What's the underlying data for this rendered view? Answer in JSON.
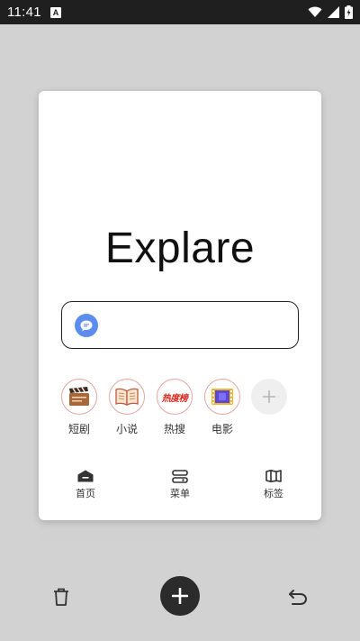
{
  "status_bar": {
    "time": "11:41",
    "app_icon_letter": "A"
  },
  "brand": {
    "title": "Explare"
  },
  "search": {
    "value": "",
    "placeholder": "",
    "engine_icon": "chat-bubble-icon",
    "engine_color": "#5b8def"
  },
  "shortcuts": [
    {
      "label": "短剧",
      "icon": "clapperboard-icon"
    },
    {
      "label": "小说",
      "icon": "open-book-icon"
    },
    {
      "label": "热搜",
      "icon": "hot-list-icon",
      "icon_text": "热度榜"
    },
    {
      "label": "电影",
      "icon": "film-strip-icon"
    }
  ],
  "add_shortcut": {
    "icon": "plus-icon"
  },
  "bottom_nav": [
    {
      "label": "首页",
      "icon": "home-icon"
    },
    {
      "label": "菜单",
      "icon": "menu-icon"
    },
    {
      "label": "标签",
      "icon": "map-icon"
    }
  ],
  "toolbar": {
    "delete_icon": "trash-icon",
    "new_tab_icon": "plus-icon",
    "undo_icon": "undo-icon"
  }
}
